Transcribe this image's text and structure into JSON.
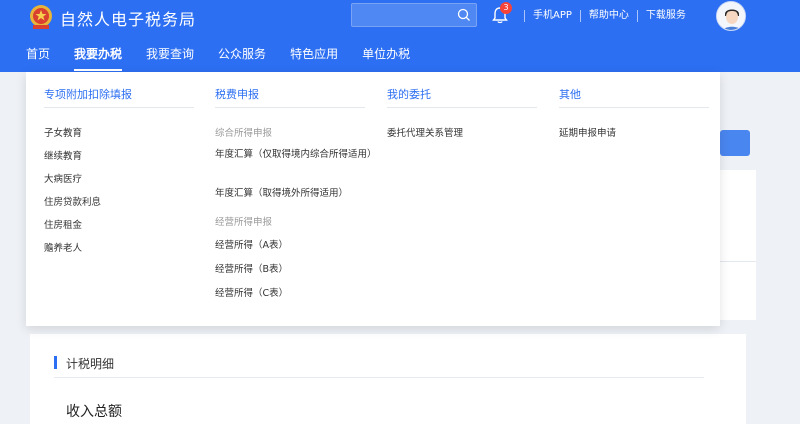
{
  "header": {
    "title": "自然人电子税务局",
    "search": {
      "placeholder": "",
      "value": ""
    },
    "notification_count": "3",
    "links": [
      "手机APP",
      "帮助中心",
      "下载服务"
    ],
    "accent_color": "#2d6ff2"
  },
  "nav": {
    "items": [
      "首页",
      "我要办税",
      "我要查询",
      "公众服务",
      "特色应用",
      "单位办税"
    ],
    "active": "我要办税"
  },
  "dropdown": {
    "columns": [
      {
        "title": "专项附加扣除填报",
        "items": [
          "子女教育",
          "继续教育",
          "大病医疗",
          "住房贷款利息",
          "住房租金",
          "赡养老人"
        ]
      },
      {
        "title": "税费申报",
        "group1": "综合所得申报",
        "group1_items": [
          "年度汇算（仅取得境内综合所得适用）",
          "年度汇算（取得境外所得适用）"
        ],
        "group2": "经营所得申报",
        "group2_items": [
          "经营所得（A表）",
          "经营所得（B表）",
          "经营所得（C表）"
        ]
      },
      {
        "title": "我的委托",
        "items": [
          "委托代理关系管理"
        ]
      },
      {
        "title": "其他",
        "items": [
          "延期申报申请"
        ]
      }
    ]
  },
  "content": {
    "section_title": "计税明细",
    "income_label": "收入总额"
  },
  "icons": {
    "logo": "tax-emblem-icon",
    "search": "search-icon",
    "bell": "bell-icon",
    "avatar": "user-avatar"
  }
}
